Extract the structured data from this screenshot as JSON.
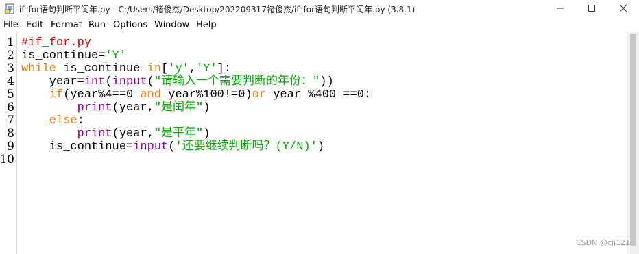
{
  "window": {
    "title": "if_for语句判断平闰年.py - C:/Users/褚俊杰/Desktop/202209317褚俊杰/if_for语句判断平闰年.py (3.8.1)",
    "controls": {
      "minimize": "—",
      "maximize": "☐",
      "close": "✕"
    }
  },
  "menu": {
    "items": [
      "File",
      "Edit",
      "Format",
      "Run",
      "Options",
      "Window",
      "Help"
    ]
  },
  "editor": {
    "line_numbers": [
      "1",
      "2",
      "3",
      "4",
      "5",
      "6",
      "7",
      "8",
      "9",
      "10"
    ],
    "lines": [
      [
        {
          "t": "#if_for.py",
          "c": "cmt-red"
        }
      ],
      [
        {
          "t": "is_continue=",
          "c": ""
        },
        {
          "t": "'Y'",
          "c": "str-green"
        }
      ],
      [
        {
          "t": "while",
          "c": "kw-orange"
        },
        {
          "t": " is_continue ",
          "c": ""
        },
        {
          "t": "in",
          "c": "kw-orange"
        },
        {
          "t": "[",
          "c": ""
        },
        {
          "t": "'y'",
          "c": "str-green"
        },
        {
          "t": ",",
          "c": ""
        },
        {
          "t": "'Y'",
          "c": "str-green"
        },
        {
          "t": "]:",
          "c": ""
        }
      ],
      [
        {
          "t": "    year=",
          "c": ""
        },
        {
          "t": "int",
          "c": "kw-purple"
        },
        {
          "t": "(",
          "c": ""
        },
        {
          "t": "input",
          "c": "kw-purple"
        },
        {
          "t": "(",
          "c": ""
        },
        {
          "t": "\"请输入一个需要判断的年份：\"",
          "c": "str-green"
        },
        {
          "t": "))",
          "c": ""
        }
      ],
      [
        {
          "t": "    ",
          "c": ""
        },
        {
          "t": "if",
          "c": "kw-orange"
        },
        {
          "t": "(year%4==0 ",
          "c": ""
        },
        {
          "t": "and",
          "c": "kw-orange"
        },
        {
          "t": " year%100!=0)",
          "c": ""
        },
        {
          "t": "or",
          "c": "kw-orange"
        },
        {
          "t": " year %400 ==0:",
          "c": ""
        }
      ],
      [
        {
          "t": "        ",
          "c": ""
        },
        {
          "t": "print",
          "c": "kw-purple"
        },
        {
          "t": "(year,",
          "c": ""
        },
        {
          "t": "\"是闰年\"",
          "c": "str-green"
        },
        {
          "t": ")",
          "c": ""
        }
      ],
      [
        {
          "t": "    ",
          "c": ""
        },
        {
          "t": "else",
          "c": "kw-orange"
        },
        {
          "t": ":",
          "c": ""
        }
      ],
      [
        {
          "t": "        ",
          "c": ""
        },
        {
          "t": "print",
          "c": "kw-purple"
        },
        {
          "t": "(year,",
          "c": ""
        },
        {
          "t": "\"是平年\"",
          "c": "str-green"
        },
        {
          "t": ")",
          "c": ""
        }
      ],
      [
        {
          "t": "    is_continue=",
          "c": ""
        },
        {
          "t": "input",
          "c": "kw-purple"
        },
        {
          "t": "(",
          "c": ""
        },
        {
          "t": "'还要继续判断吗？(Y/N)'",
          "c": "str-green"
        },
        {
          "t": ")",
          "c": ""
        }
      ],
      []
    ]
  },
  "watermark": "CSDN @cjj121",
  "colors": {
    "keyword": "#ff7700",
    "builtin": "#900090",
    "string": "#00aa00",
    "comment": "#dd0000"
  },
  "icons": {
    "app": "python-idle-file-icon",
    "minimize": "minimize-icon",
    "maximize": "maximize-icon",
    "close": "close-icon"
  }
}
